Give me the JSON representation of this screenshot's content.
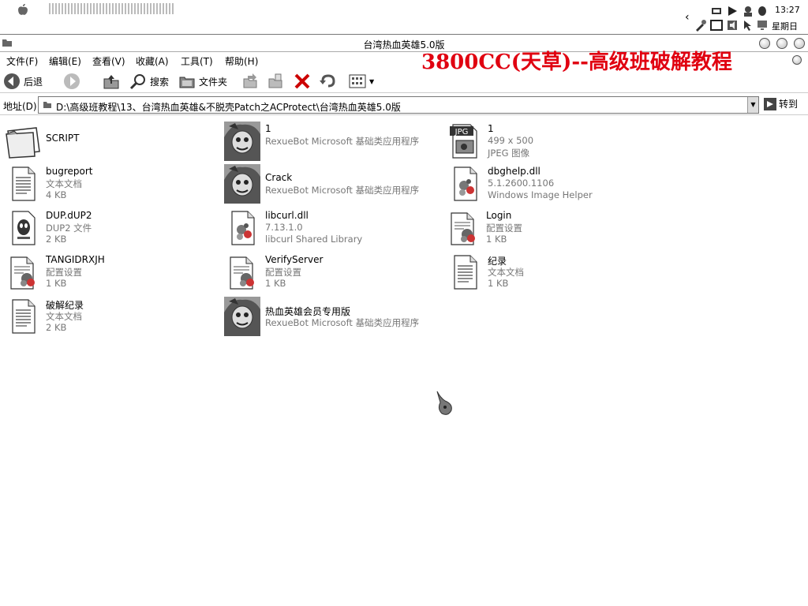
{
  "system": {
    "clock": "13:27",
    "weekday": "星期日"
  },
  "window": {
    "title": "台湾热血英雄5.0版"
  },
  "watermark": "3800CC(天草)--高级班破解教程",
  "menus": [
    "文件(F)",
    "编辑(E)",
    "查看(V)",
    "收藏(A)",
    "工具(T)",
    "帮助(H)"
  ],
  "toolbar": {
    "back_label": "后退",
    "search_label": "搜索",
    "folders_label": "文件夹"
  },
  "address": {
    "label": "地址(D)",
    "path": "D:\\高级班教程\\13、台湾热血英雄&不脱壳Patch之ACProtect\\台湾热血英雄5.0版",
    "go_label": "转到"
  },
  "files": [
    {
      "name": "SCRIPT",
      "desc": "",
      "size": "",
      "icon": "folder-icon"
    },
    {
      "name": "1",
      "desc": "RexueBot Microsoft 基础类应用程序",
      "size": "",
      "icon": "app-icon"
    },
    {
      "name": "1",
      "desc": "499 x 500",
      "size": "JPEG 图像",
      "icon": "jpg-icon"
    },
    {
      "name": "bugreport",
      "desc": "文本文档",
      "size": "4 KB",
      "icon": "text-doc-icon"
    },
    {
      "name": "Crack",
      "desc": "RexueBot Microsoft 基础类应用程序",
      "size": "",
      "icon": "app-icon"
    },
    {
      "name": "dbghelp.dll",
      "desc": "5.1.2600.1106",
      "size": "Windows Image Helper",
      "icon": "dll-icon"
    },
    {
      "name": "DUP.dUP2",
      "desc": "DUP2 文件",
      "size": "2 KB",
      "icon": "dup-icon"
    },
    {
      "name": "libcurl.dll",
      "desc": "7.13.1.0",
      "size": "libcurl Shared Library",
      "icon": "dll-icon"
    },
    {
      "name": "Login",
      "desc": "配置设置",
      "size": "1 KB",
      "icon": "config-icon"
    },
    {
      "name": "TANGIDRXJH",
      "desc": "配置设置",
      "size": "1 KB",
      "icon": "config-icon"
    },
    {
      "name": "VerifyServer",
      "desc": "配置设置",
      "size": "1 KB",
      "icon": "config-icon"
    },
    {
      "name": "纪录",
      "desc": "文本文档",
      "size": "1 KB",
      "icon": "text-doc-icon"
    },
    {
      "name": "破解纪录",
      "desc": "文本文档",
      "size": "2 KB",
      "icon": "text-doc-icon"
    },
    {
      "name": "热血英雄会员专用版",
      "desc": "RexueBot Microsoft 基础类应用程序",
      "size": "",
      "icon": "app-icon"
    }
  ]
}
